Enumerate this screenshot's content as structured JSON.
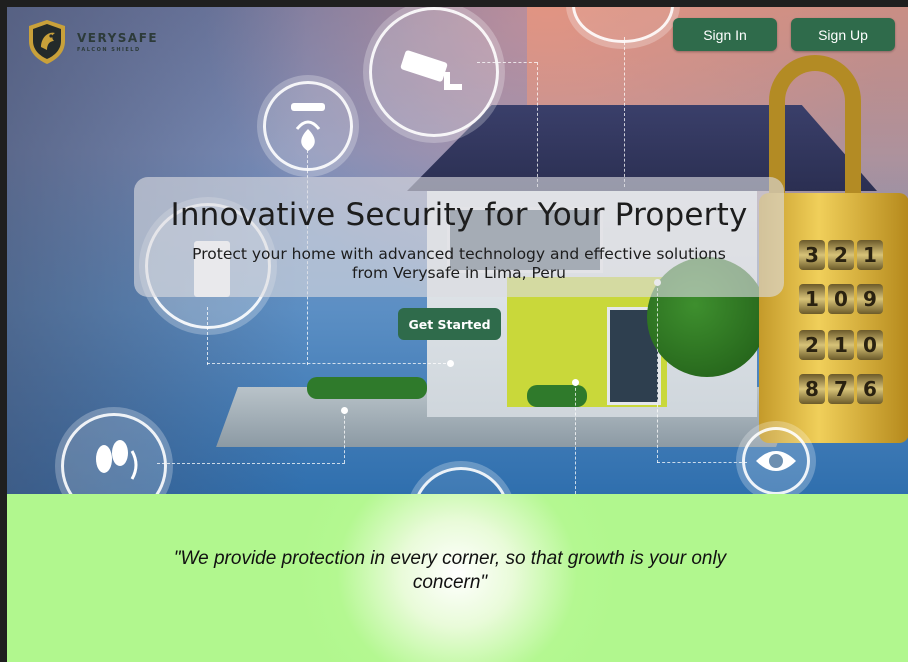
{
  "brand": {
    "name": "VERYSAFE",
    "tagline": "FALCON SHIELD"
  },
  "nav": {
    "sign_in": "Sign In",
    "sign_up": "Sign Up"
  },
  "hero": {
    "title": "Innovative Security for Your Property",
    "subtitle": "Protect your home with advanced technology and effective solutions from Verysafe in Lima, Peru",
    "cta": "Get Started"
  },
  "lock_dials": [
    [
      "3",
      "2",
      "1"
    ],
    [
      "1",
      "0",
      "9"
    ],
    [
      "2",
      "1",
      "0"
    ],
    [
      "8",
      "7",
      "6"
    ]
  ],
  "quote": "\"We provide protection in every corner, so that growth is your only concern\"",
  "colors": {
    "button": "#2f6b4b",
    "quote_band": "#b1f78e",
    "logo_gold": "#c9a13a"
  },
  "icons": [
    "security-camera-icon",
    "smoke-detector-icon",
    "footsteps-icon",
    "eye-icon",
    "phone-icon",
    "shield-falcon-icon"
  ]
}
